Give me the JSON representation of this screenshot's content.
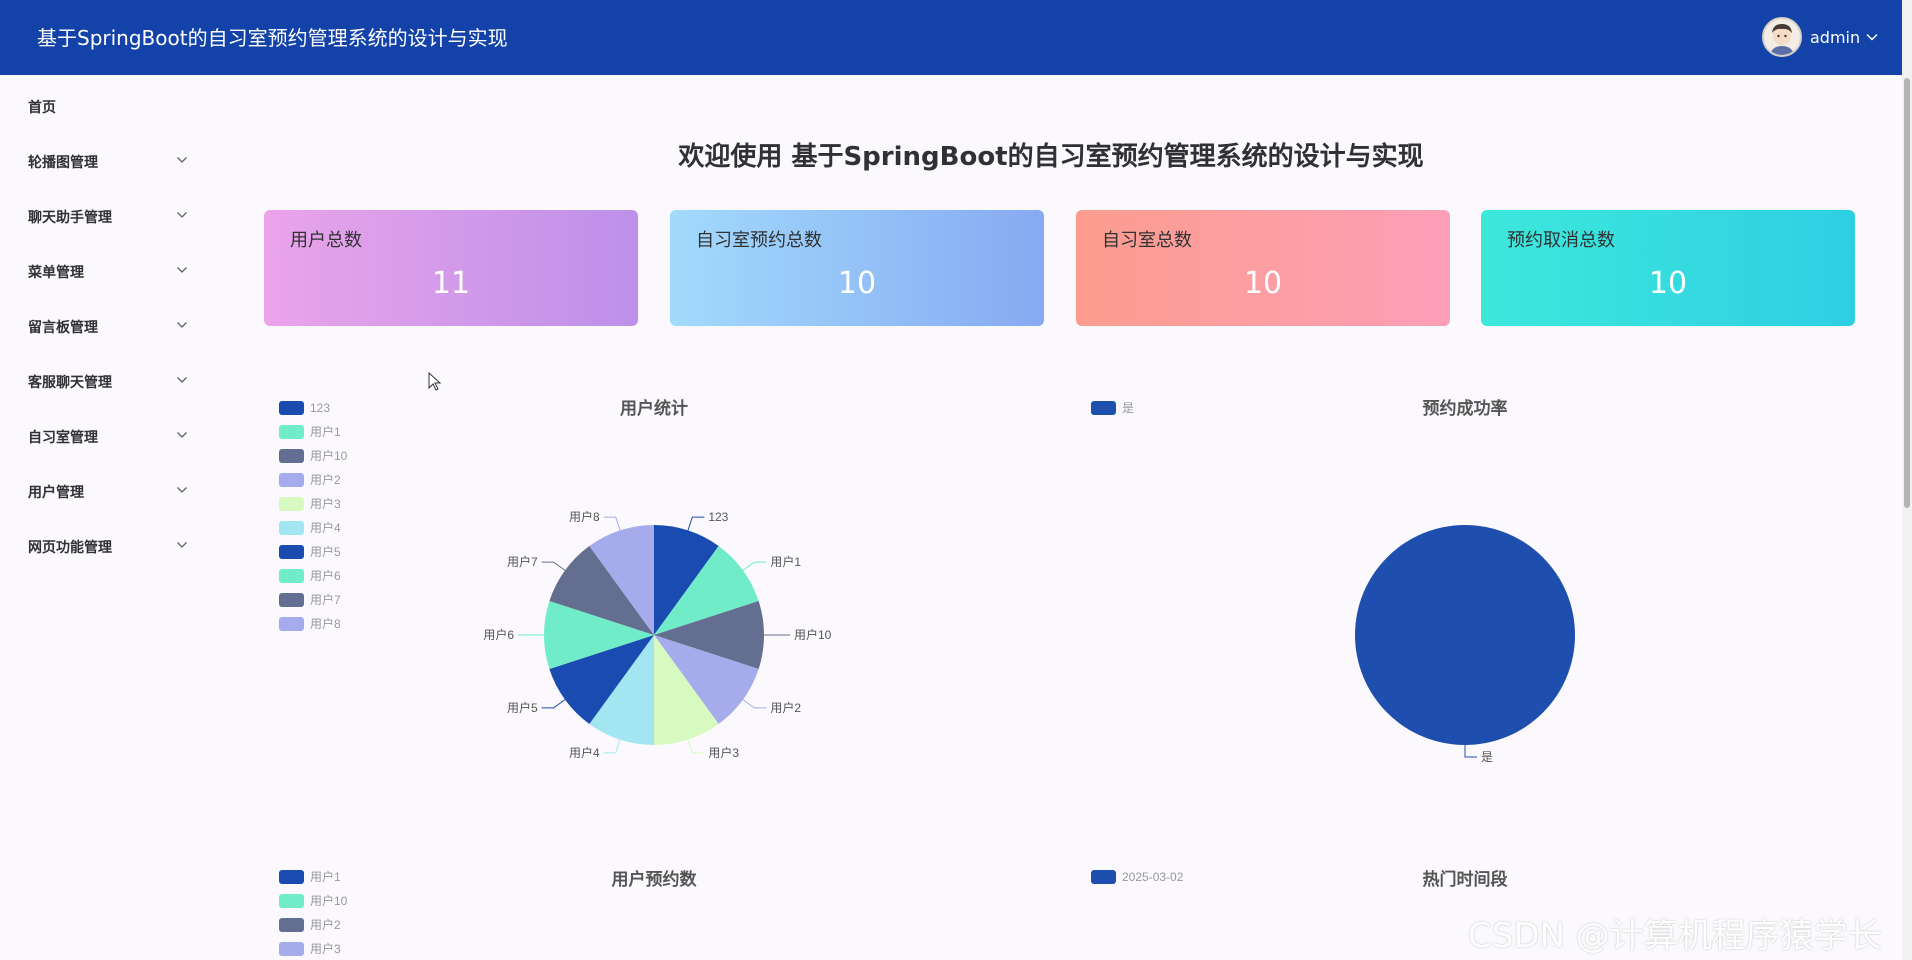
{
  "header": {
    "app_title": "基于SpringBoot的自习室预约管理系统的设计与实现",
    "username": "admin",
    "avatar_icon": "user-avatar",
    "caret_icon": "chevron-down-icon",
    "background": "#1343a8"
  },
  "sidebar": {
    "items": [
      {
        "label": "首页",
        "has_children": false
      },
      {
        "label": "轮播图管理",
        "has_children": true
      },
      {
        "label": "聊天助手管理",
        "has_children": true
      },
      {
        "label": "菜单管理",
        "has_children": true
      },
      {
        "label": "留言板管理",
        "has_children": true
      },
      {
        "label": "客服聊天管理",
        "has_children": true
      },
      {
        "label": "自习室管理",
        "has_children": true
      },
      {
        "label": "用户管理",
        "has_children": true
      },
      {
        "label": "网页功能管理",
        "has_children": true
      }
    ]
  },
  "main": {
    "welcome": "欢迎使用 基于SpringBoot的自习室预约管理系统的设计与实现",
    "stats": [
      {
        "label": "用户总数",
        "value": "11"
      },
      {
        "label": "自习室预约总数",
        "value": "10"
      },
      {
        "label": "自习室总数",
        "value": "10"
      },
      {
        "label": "预约取消总数",
        "value": "10"
      }
    ]
  },
  "chart_data": [
    {
      "type": "pie",
      "title": "用户统计",
      "labels": [
        "123",
        "用户1",
        "用户10",
        "用户2",
        "用户3",
        "用户4",
        "用户5",
        "用户6",
        "用户7",
        "用户8"
      ],
      "values": [
        1,
        1,
        1,
        1,
        1,
        1,
        1,
        1,
        1,
        1
      ],
      "colors": [
        "#1a4bb0",
        "#70ecc9",
        "#636e90",
        "#a6aceb",
        "#d6fac0",
        "#a2e6f2",
        "#1a4bb0",
        "#70ecc9",
        "#636e90",
        "#a6aceb"
      ],
      "legend": "top-left"
    },
    {
      "type": "pie",
      "title": "预约成功率",
      "labels": [
        "是"
      ],
      "values": [
        1
      ],
      "colors": [
        "#1f4fae"
      ],
      "legend": "top-left"
    },
    {
      "type": "pie",
      "title": "用户预约数",
      "labels": [
        "用户1",
        "用户10",
        "用户2",
        "用户3"
      ],
      "colors": [
        "#1a4bb0",
        "#70ecc9",
        "#636e90",
        "#a6aceb"
      ],
      "legend": "top-left"
    },
    {
      "type": "bar",
      "title": "热门时间段",
      "series": [
        {
          "name": "2025-03-02",
          "color": "#1f4fae"
        }
      ],
      "legend": "top-left"
    }
  ],
  "watermark": "CSDN @计算机程序猿学长"
}
